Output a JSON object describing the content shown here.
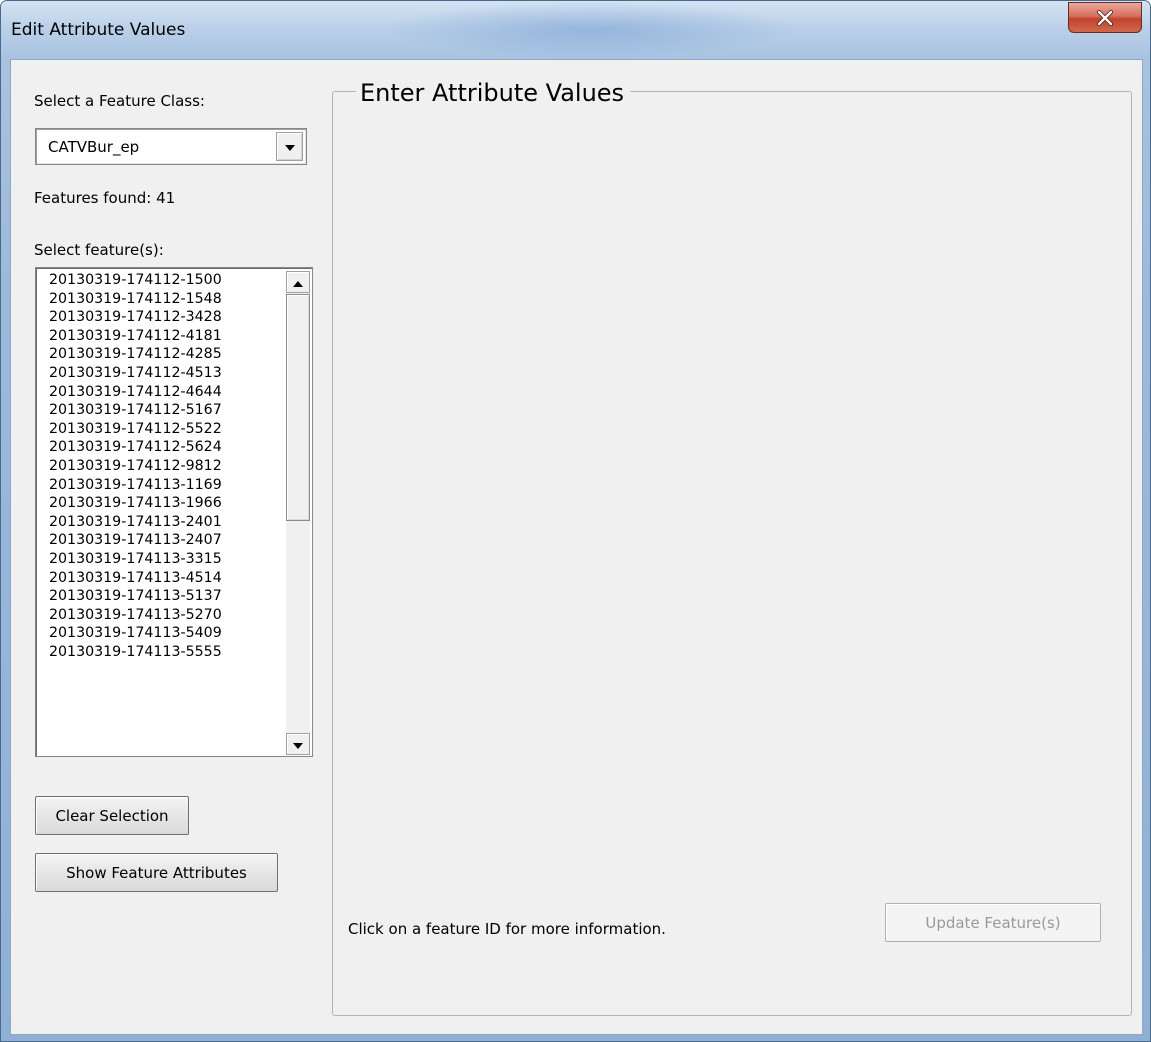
{
  "window": {
    "title": "Edit Attribute Values",
    "close_glyph": "x"
  },
  "left_panel": {
    "feature_class_label": "Select a Feature Class:",
    "feature_class_value": "CATVBur_ep",
    "features_found": "Features found: 41",
    "select_features_label": "Select feature(s):",
    "features": [
      "20130319-174112-1500",
      "20130319-174112-1548",
      "20130319-174112-3428",
      "20130319-174112-4181",
      "20130319-174112-4285",
      "20130319-174112-4513",
      "20130319-174112-4644",
      "20130319-174112-5167",
      "20130319-174112-5522",
      "20130319-174112-5624",
      "20130319-174112-9812",
      "20130319-174113-1169",
      "20130319-174113-1966",
      "20130319-174113-2401",
      "20130319-174113-2407",
      "20130319-174113-3315",
      "20130319-174113-4514",
      "20130319-174113-5137",
      "20130319-174113-5270",
      "20130319-174113-5409",
      "20130319-174113-5555"
    ],
    "clear_selection_label": "Clear Selection",
    "show_attributes_label": "Show Feature Attributes"
  },
  "group": {
    "title": "Enter Attribute Values",
    "hint": "Click on a feature ID for more information.",
    "update_label": "Update Feature(s)"
  },
  "icons": {
    "close": "close-icon",
    "dropdown": "triangle-down-icon",
    "scroll_up": "triangle-up-icon",
    "scroll_down": "triangle-down-icon"
  },
  "colors": {
    "close_button": "#c2422c",
    "client_background": "#f0f0f0",
    "disabled_text": "#9a9a9a"
  }
}
